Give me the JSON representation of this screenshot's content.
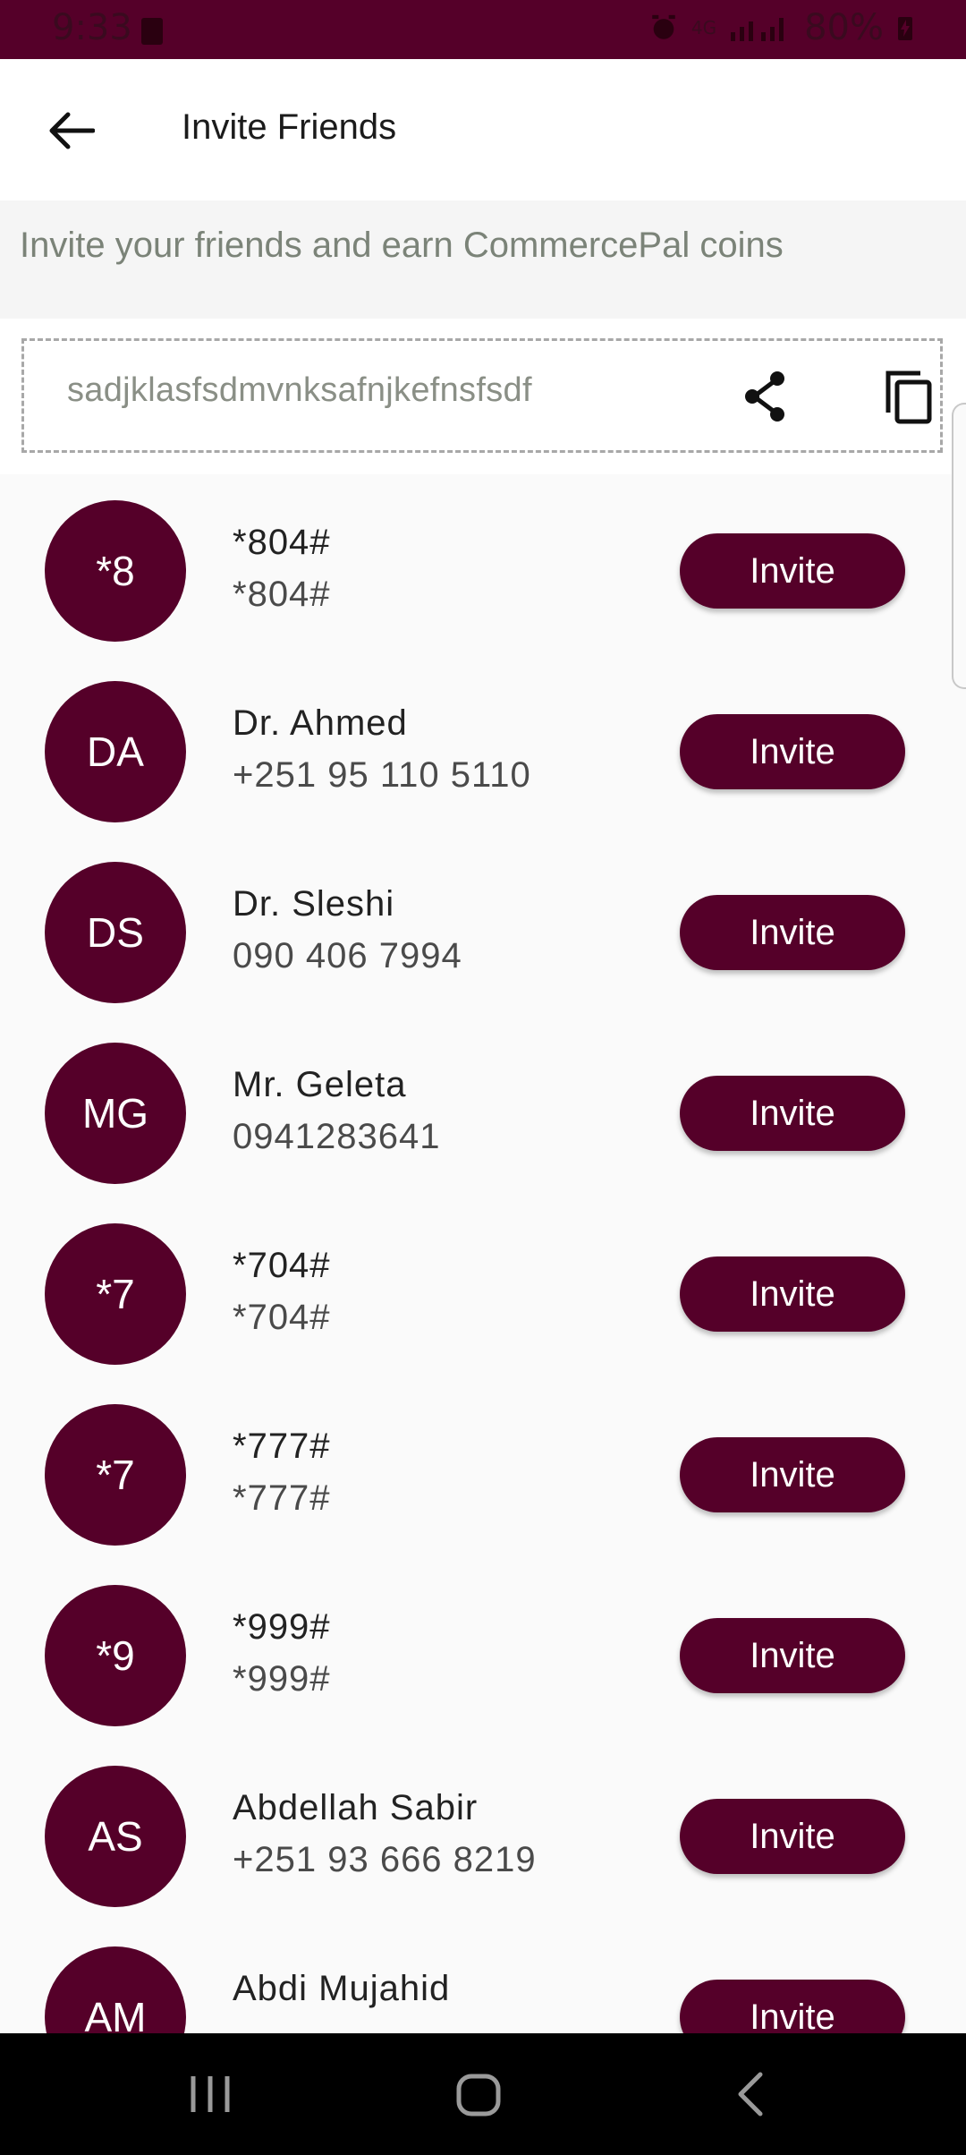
{
  "status_bar": {
    "time": "9:33",
    "battery": "80%",
    "network": "4G"
  },
  "header": {
    "title": "Invite Friends",
    "back_icon": "arrow-left-icon"
  },
  "subtitle": "Invite your friends and earn CommercePal coins",
  "referral": {
    "code": "sadjklasfsdmvnksafnjkefnsfsdf",
    "share_icon": "share-icon",
    "copy_icon": "copy-icon"
  },
  "contacts": [
    {
      "initials": "*8",
      "name": "*804#",
      "phone": "*804#",
      "button": "Invite"
    },
    {
      "initials": "DA",
      "name": "Dr. Ahmed",
      "phone": "+251 95 110 5110",
      "button": "Invite"
    },
    {
      "initials": "DS",
      "name": "Dr. Sleshi",
      "phone": "090 406 7994",
      "button": "Invite"
    },
    {
      "initials": "MG",
      "name": "Mr. Geleta",
      "phone": "0941283641",
      "button": "Invite"
    },
    {
      "initials": "*7",
      "name": "*704#",
      "phone": "*704#",
      "button": "Invite"
    },
    {
      "initials": "*7",
      "name": "*777#",
      "phone": "*777#",
      "button": "Invite"
    },
    {
      "initials": "*9",
      "name": "*999#",
      "phone": "*999#",
      "button": "Invite"
    },
    {
      "initials": "AS",
      "name": "Abdellah Sabir",
      "phone": "+251 93 666 8219",
      "button": "Invite"
    },
    {
      "initials": "AM",
      "name": "Abdi Mujahid",
      "phone": "",
      "button": "Invite"
    }
  ],
  "colors": {
    "primary": "#550029",
    "background": "#fafafa",
    "subtitle_text": "#7b8378"
  }
}
